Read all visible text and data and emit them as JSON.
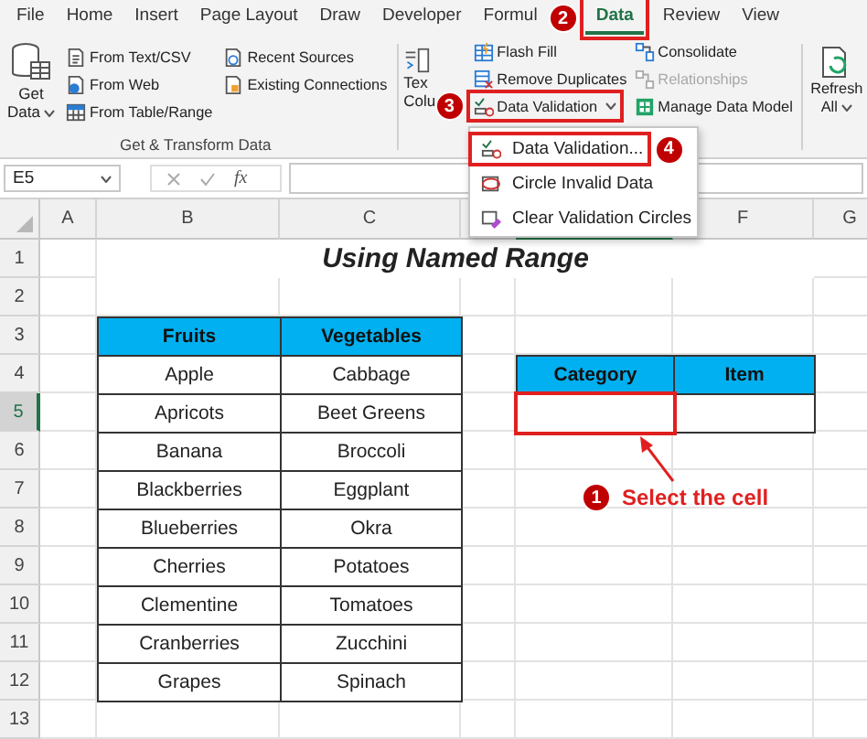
{
  "ribbon_tabs": [
    {
      "label": "File",
      "selected": false
    },
    {
      "label": "Home",
      "selected": false
    },
    {
      "label": "Insert",
      "selected": false
    },
    {
      "label": "Page Layout",
      "selected": false
    },
    {
      "label": "Draw",
      "selected": false
    },
    {
      "label": "Developer",
      "selected": false
    },
    {
      "label": "Formul",
      "selected": false
    },
    {
      "label": "Data",
      "selected": true,
      "step": "2"
    },
    {
      "label": "Review",
      "selected": false
    },
    {
      "label": "View",
      "selected": false
    }
  ],
  "get_transform_group": {
    "get_data": {
      "line_1": "Get",
      "line_2": "Data"
    },
    "commands": [
      {
        "label": "From Text/CSV",
        "kind": "text-file"
      },
      {
        "label": "From Web",
        "kind": "web"
      },
      {
        "label": "From Table/Range",
        "kind": "table"
      },
      {
        "label": "Recent Sources",
        "kind": "recent"
      },
      {
        "label": "Existing Connections",
        "kind": "connections"
      }
    ],
    "label": "Get & Transform Data"
  },
  "text_to_columns": {
    "line_1": "Tex",
    "line_2": "Colu"
  },
  "data_tools": [
    {
      "label": "Flash Fill",
      "kind": "flash-fill",
      "disabled": false,
      "dropdown": false
    },
    {
      "label": "Remove Duplicates",
      "kind": "duplicates",
      "disabled": false,
      "dropdown": false
    },
    {
      "label": "Data Validation",
      "kind": "validation",
      "disabled": false,
      "dropdown": true,
      "step": "3"
    }
  ],
  "data_model": [
    {
      "label": "Consolidate",
      "kind": "consolidate",
      "disabled": false
    },
    {
      "label": "Relationships",
      "kind": "relationships",
      "disabled": true
    },
    {
      "label": "Manage Data Model",
      "kind": "data-model",
      "disabled": false
    }
  ],
  "refresh": {
    "line_1": "Refresh",
    "line_2": "All"
  },
  "formula_bar": {
    "name_box": "E5",
    "function_label": "fx"
  },
  "columns": [
    {
      "label": "A",
      "selected": false
    },
    {
      "label": "B",
      "selected": false
    },
    {
      "label": "C",
      "selected": false
    },
    {
      "selected": false
    },
    {
      "selected": true
    },
    {
      "label": "F",
      "selected": false
    },
    {
      "label": "G",
      "selected": false
    }
  ],
  "rows": [
    {
      "label": "1",
      "selected": false
    },
    {
      "label": "2",
      "selected": false
    },
    {
      "label": "3",
      "selected": false
    },
    {
      "label": "4",
      "selected": false
    },
    {
      "label": "5",
      "selected": true
    },
    {
      "label": "6",
      "selected": false
    },
    {
      "label": "7",
      "selected": false
    },
    {
      "label": "8",
      "selected": false
    },
    {
      "label": "9",
      "selected": false
    },
    {
      "label": "10",
      "selected": false
    },
    {
      "label": "11",
      "selected": false
    },
    {
      "label": "12",
      "selected": false
    },
    {
      "label": "13",
      "selected": false
    }
  ],
  "title": "Using Named Range",
  "produce_table": {
    "columns": [
      "Fruits",
      "Vegetables"
    ],
    "rows": [
      [
        "Apple",
        "Cabbage"
      ],
      [
        "Apricots",
        "Beet Greens"
      ],
      [
        "Banana",
        "Broccoli"
      ],
      [
        "Blackberries",
        "Eggplant"
      ],
      [
        "Blueberries",
        "Okra"
      ],
      [
        "Cherries",
        "Potatoes"
      ],
      [
        "Clementine",
        "Tomatoes"
      ],
      [
        "Cranberries",
        "Zucchini"
      ],
      [
        "Grapes",
        "Spinach"
      ]
    ]
  },
  "selection_table": {
    "columns": [
      "Category",
      "Item"
    ],
    "framed": true
  },
  "dropdown_menu": [
    {
      "label": "Data Validation...",
      "kind": "validation",
      "step": "4"
    },
    {
      "label": "Circle Invalid Data",
      "kind": "circle"
    },
    {
      "label": "Clear Validation Circles",
      "kind": "clear"
    }
  ],
  "callout": {
    "step": "1",
    "text": "Select the cell"
  }
}
